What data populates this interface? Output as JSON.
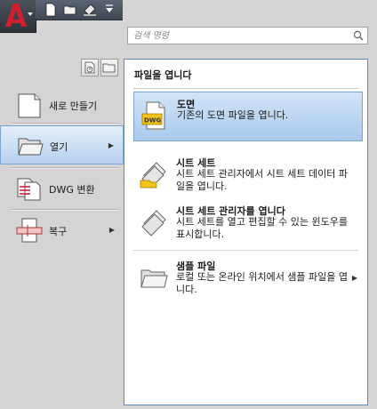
{
  "search": {
    "placeholder": "검색 명령"
  },
  "left_menu": {
    "items": [
      {
        "label": "새로 만들기"
      },
      {
        "label": "열기"
      },
      {
        "label": "DWG 변환"
      },
      {
        "label": "복구"
      }
    ]
  },
  "open_panel": {
    "title": "파일을 엽니다",
    "items": [
      {
        "title": "도면",
        "desc": "기존의 도면 파일을 엽니다."
      },
      {
        "title": "시트 세트",
        "desc": "시트 세트 관리자에서 시트 세트 데이터 파일을 엽니다."
      },
      {
        "title": "시트 세트 관리자를 엽니다",
        "desc": "시트 세트를 열고 편집할 수 있는 윈도우를 표시합니다."
      },
      {
        "title": "샘플 파일",
        "desc": "로컬 또는 온라인 위치에서 샘플 파일을 엽니다."
      }
    ]
  },
  "colors": {
    "accent": "#b9d3ef",
    "app_red": "#c8102e",
    "border_blue": "#5e88b8"
  }
}
